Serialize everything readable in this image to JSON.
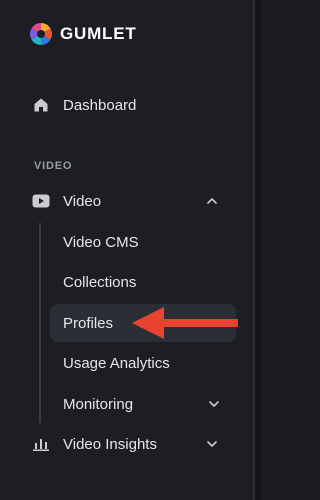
{
  "brand": {
    "name": "GUMLET"
  },
  "nav": {
    "dashboard": {
      "label": "Dashboard",
      "icon": "home-icon"
    },
    "section_video": "VIDEO",
    "video": {
      "label": "Video",
      "icon": "youtube-icon",
      "expanded": true
    },
    "video_children": [
      {
        "label": "Video CMS"
      },
      {
        "label": "Collections"
      },
      {
        "label": "Profiles",
        "active": true
      },
      {
        "label": "Usage Analytics"
      },
      {
        "label": "Monitoring",
        "has_submenu": true
      }
    ],
    "video_insights": {
      "label": "Video Insights",
      "icon": "bar-chart-icon",
      "has_submenu": true
    }
  },
  "annotation": {
    "type": "arrow",
    "color": "#e8432e",
    "points_to": "Profiles"
  },
  "colors": {
    "background": "#1c1e23",
    "active_item": "#2b2e34",
    "text": "#e6e7ea",
    "section_label": "#9a9ea7"
  }
}
